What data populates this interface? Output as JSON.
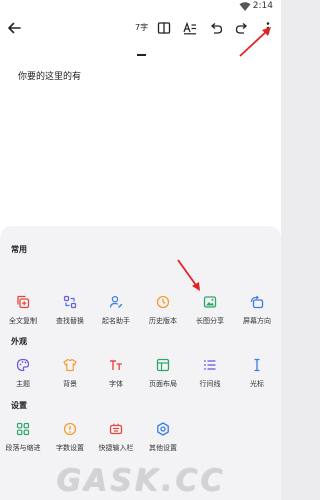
{
  "status": {
    "time": "2:14"
  },
  "toolbar": {
    "word_count": "7字"
  },
  "document": {
    "text": "你要的这里的有"
  },
  "sections": [
    {
      "title": "常用",
      "items": [
        {
          "label": "全文复制",
          "icon": "copy-icon"
        },
        {
          "label": "查找替换",
          "icon": "find-replace-icon"
        },
        {
          "label": "起名助手",
          "icon": "name-assistant-icon"
        },
        {
          "label": "历史版本",
          "icon": "history-icon"
        },
        {
          "label": "长图分享",
          "icon": "image-share-icon"
        },
        {
          "label": "屏幕方向",
          "icon": "screen-rotate-icon"
        }
      ]
    },
    {
      "title": "外观",
      "items": [
        {
          "label": "主题",
          "icon": "palette-icon"
        },
        {
          "label": "背景",
          "icon": "shirt-icon"
        },
        {
          "label": "字体",
          "icon": "font-icon"
        },
        {
          "label": "页面布局",
          "icon": "layout-icon"
        },
        {
          "label": "行间线",
          "icon": "line-spacing-icon"
        },
        {
          "label": "光标",
          "icon": "cursor-icon"
        }
      ]
    },
    {
      "title": "设置",
      "items": [
        {
          "label": "段落与缩进",
          "icon": "paragraph-icon"
        },
        {
          "label": "字数设置",
          "icon": "word-count-icon"
        },
        {
          "label": "快捷输入栏",
          "icon": "quick-input-icon"
        },
        {
          "label": "其他设置",
          "icon": "settings-icon"
        }
      ]
    }
  ],
  "watermark": {
    "text": "GASK.CC"
  },
  "colors": {
    "red": "#e8453c",
    "orange": "#f0a030",
    "blue": "#3b7de0",
    "green": "#2ea66a",
    "purple": "#6b5bd6",
    "annotation": "#e02424"
  }
}
